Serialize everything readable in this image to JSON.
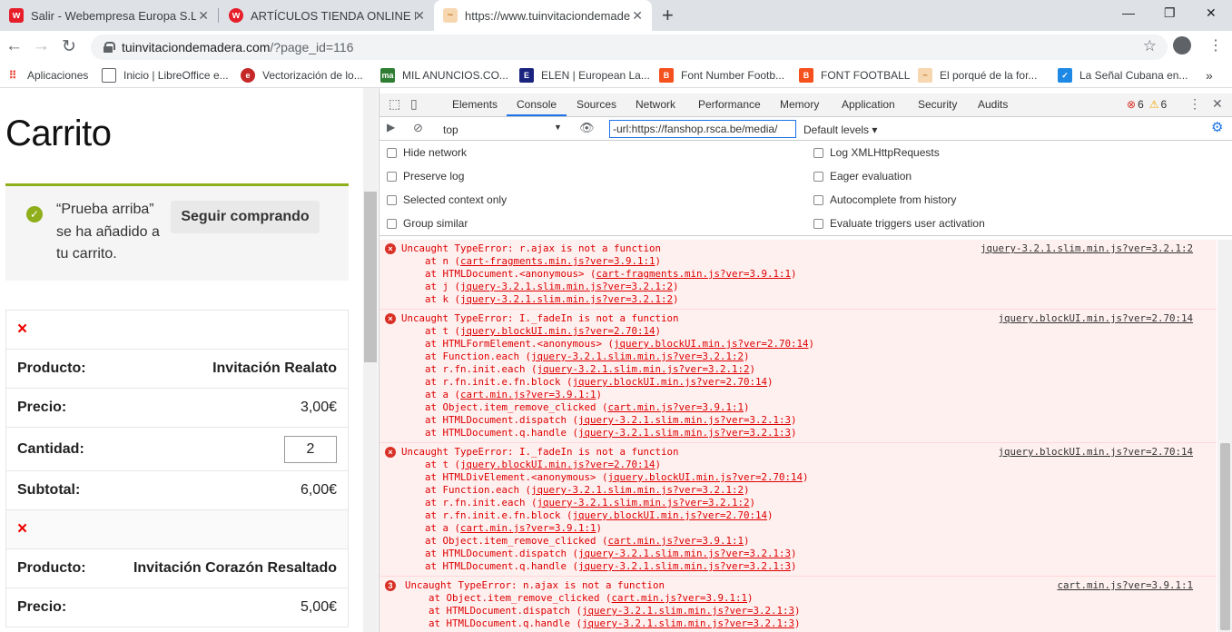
{
  "tabs": [
    {
      "title": "Salir - Webempresa Europa S.L.",
      "fav": "w",
      "color": "#e61e2a"
    },
    {
      "title": "ARTÍCULOS TIENDA ONLINE NO",
      "fav": "w",
      "color": "#e61e2a"
    },
    {
      "title": "https://www.tuinvitaciondemade",
      "fav": "~",
      "color": "#e8a050"
    }
  ],
  "address": {
    "host": "tuinvitaciondemadera.com",
    "path": "/?page_id=116"
  },
  "bookmarks": [
    {
      "label": "Aplicaciones",
      "color": "#ea4335"
    },
    {
      "label": "Inicio | LibreOffice e...",
      "color": "#ffffff"
    },
    {
      "label": "Vectorización de lo...",
      "color": "#c62828"
    },
    {
      "label": "MIL ANUNCIOS.CO...",
      "color": "#2e7d32"
    },
    {
      "label": "ELEN | European La...",
      "color": "#1a237e"
    },
    {
      "label": "Font Number Footb...",
      "color": "#f4511e"
    },
    {
      "label": "FONT FOOTBALL",
      "color": "#f4511e"
    },
    {
      "label": "El porqué de la for...",
      "color": "#e6a23c"
    },
    {
      "label": "La Señal Cubana en...",
      "color": "#1e88e5"
    }
  ],
  "page": {
    "title": "Carrito",
    "notice": "“Prueba arriba” se ha añadido a tu carrito.",
    "continue_btn": "Seguir comprando",
    "items": [
      {
        "remove": "×",
        "product_label": "Producto:",
        "product": "Invitación Realato",
        "price_label": "Precio:",
        "price": "3,00€",
        "qty_label": "Cantidad:",
        "qty": "2",
        "subtotal_label": "Subtotal:",
        "subtotal": "6,00€"
      },
      {
        "remove": "×",
        "product_label": "Producto:",
        "product": "Invitación Corazón Resaltado",
        "price_label": "Precio:",
        "price": "5,00€"
      }
    ]
  },
  "devtools": {
    "tabs": [
      "Elements",
      "Console",
      "Sources",
      "Network",
      "Performance",
      "Memory",
      "Application",
      "Security",
      "Audits"
    ],
    "active_tab": "Console",
    "errors": "6",
    "warnings": "6",
    "context": "top",
    "filter": "-url:https://fanshop.rsca.be/media/",
    "levels": "Default levels ▾",
    "options_left": [
      "Hide network",
      "Preserve log",
      "Selected context only",
      "Group similar"
    ],
    "options_right": [
      "Log XMLHttpRequests",
      "Eager evaluation",
      "Autocomplete from history",
      "Evaluate triggers user activation"
    ],
    "logs": [
      {
        "icon": "×",
        "msg": "Uncaught TypeError: r.ajax is not a function",
        "src": "jquery-3.2.1.slim.min.js?ver=3.2.1:2",
        "frames": [
          [
            "at n (",
            "cart-fragments.min.js?ver=3.9.1:1",
            ")"
          ],
          [
            "at HTMLDocument.<anonymous> (",
            "cart-fragments.min.js?ver=3.9.1:1",
            ")"
          ],
          [
            "at j (",
            "jquery-3.2.1.slim.min.js?ver=3.2.1:2",
            ")"
          ],
          [
            "at k (",
            "jquery-3.2.1.slim.min.js?ver=3.2.1:2",
            ")"
          ]
        ]
      },
      {
        "icon": "×",
        "msg": "Uncaught TypeError: I._fadeIn is not a function",
        "src": "jquery.blockUI.min.js?ver=2.70:14",
        "frames": [
          [
            "at t (",
            "jquery.blockUI.min.js?ver=2.70:14",
            ")"
          ],
          [
            "at HTMLFormElement.<anonymous> (",
            "jquery.blockUI.min.js?ver=2.70:14",
            ")"
          ],
          [
            "at Function.each (",
            "jquery-3.2.1.slim.min.js?ver=3.2.1:2",
            ")"
          ],
          [
            "at r.fn.init.each (",
            "jquery-3.2.1.slim.min.js?ver=3.2.1:2",
            ")"
          ],
          [
            "at r.fn.init.e.fn.block (",
            "jquery.blockUI.min.js?ver=2.70:14",
            ")"
          ],
          [
            "at a (",
            "cart.min.js?ver=3.9.1:1",
            ")"
          ],
          [
            "at Object.item_remove_clicked (",
            "cart.min.js?ver=3.9.1:1",
            ")"
          ],
          [
            "at HTMLDocument.dispatch (",
            "jquery-3.2.1.slim.min.js?ver=3.2.1:3",
            ")"
          ],
          [
            "at HTMLDocument.q.handle (",
            "jquery-3.2.1.slim.min.js?ver=3.2.1:3",
            ")"
          ]
        ]
      },
      {
        "icon": "×",
        "msg": "Uncaught TypeError: I._fadeIn is not a function",
        "src": "jquery.blockUI.min.js?ver=2.70:14",
        "frames": [
          [
            "at t (",
            "jquery.blockUI.min.js?ver=2.70:14",
            ")"
          ],
          [
            "at HTMLDivElement.<anonymous> (",
            "jquery.blockUI.min.js?ver=2.70:14",
            ")"
          ],
          [
            "at Function.each (",
            "jquery-3.2.1.slim.min.js?ver=3.2.1:2",
            ")"
          ],
          [
            "at r.fn.init.each (",
            "jquery-3.2.1.slim.min.js?ver=3.2.1:2",
            ")"
          ],
          [
            "at r.fn.init.e.fn.block (",
            "jquery.blockUI.min.js?ver=2.70:14",
            ")"
          ],
          [
            "at a (",
            "cart.min.js?ver=3.9.1:1",
            ")"
          ],
          [
            "at Object.item_remove_clicked (",
            "cart.min.js?ver=3.9.1:1",
            ")"
          ],
          [
            "at HTMLDocument.dispatch (",
            "jquery-3.2.1.slim.min.js?ver=3.2.1:3",
            ")"
          ],
          [
            "at HTMLDocument.q.handle (",
            "jquery-3.2.1.slim.min.js?ver=3.2.1:3",
            ")"
          ]
        ]
      },
      {
        "icon": "3",
        "msg": "Uncaught TypeError: n.ajax is not a function",
        "src": "cart.min.js?ver=3.9.1:1",
        "frames": [
          [
            "at Object.item_remove_clicked (",
            "cart.min.js?ver=3.9.1:1",
            ")"
          ],
          [
            "at HTMLDocument.dispatch (",
            "jquery-3.2.1.slim.min.js?ver=3.2.1:3",
            ")"
          ],
          [
            "at HTMLDocument.q.handle (",
            "jquery-3.2.1.slim.min.js?ver=3.2.1:3",
            ")"
          ]
        ]
      }
    ]
  }
}
